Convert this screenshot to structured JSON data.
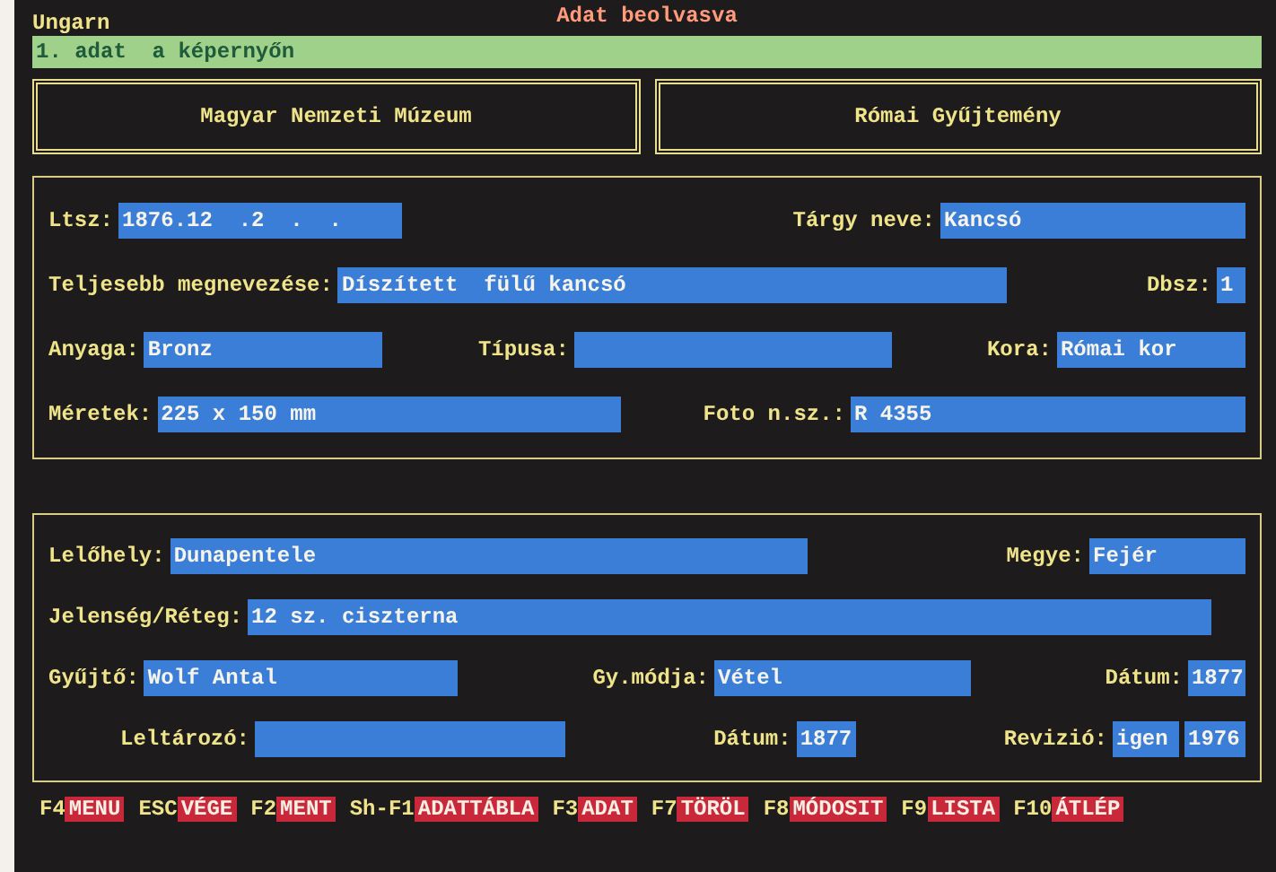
{
  "header": {
    "title": "Ungarn",
    "status": "Adat beolvasva"
  },
  "message": "1. adat  a képernyőn",
  "collections": [
    "Magyar Nemzeti Múzeum",
    "Római Gyűjtemény"
  ],
  "panels": [
    {
      "rows": [
        [
          {
            "label": "Ltsz:",
            "values": [
              "1876.12  .2  .  ."
            ]
          },
          {
            "label": "Tárgy neve:",
            "values": [
              "Kancsó"
            ]
          }
        ],
        [
          {
            "label": "Teljesebb megnevezése:",
            "values": [
              "Díszített  fülű kancsó"
            ]
          },
          {
            "label": "Dbsz:",
            "values": [
              "1"
            ]
          }
        ],
        [
          {
            "label": "Anyaga:",
            "values": [
              "Bronz"
            ]
          },
          {
            "label": "Típusa:"
          },
          {
            "label": "Kora:",
            "values": [
              "Római kor"
            ]
          }
        ],
        [
          {
            "label": "Méretek:",
            "values": [
              "225 x 150 mm"
            ]
          },
          {
            "label": "Foto n.sz.:",
            "values": [
              "R 4355"
            ]
          }
        ]
      ]
    },
    {
      "rows": [
        [
          {
            "label": "Lelőhely:",
            "values": [
              "Dunapentele"
            ]
          },
          {
            "label": "Megye:",
            "values": [
              "Fejér"
            ]
          }
        ],
        [
          {
            "label": "Jelenség/Réteg:",
            "values": [
              "12 sz. ciszterna"
            ]
          }
        ],
        [
          {
            "label": "Gyűjtő:",
            "values": [
              "Wolf Antal"
            ]
          },
          {
            "label": "Gy.módja:",
            "values": [
              "Vétel"
            ]
          },
          {
            "label": "Dátum:",
            "values": [
              "1877"
            ]
          }
        ],
        [
          {
            "label": "Leltározó:"
          },
          {
            "label": "Dátum:",
            "values": [
              "1877"
            ]
          },
          {
            "label": "Revizió:",
            "values": [
              "igen",
              "1976"
            ]
          }
        ]
      ]
    }
  ],
  "function_keys": [
    {
      "key": "F4",
      "action": "MENU"
    },
    {
      "key": "ESC",
      "action": "VÉGE"
    },
    {
      "key": "F2",
      "action": "MENT"
    },
    {
      "key": "Sh-F1",
      "action": "ADATTÁBLA"
    },
    {
      "key": "F3",
      "action": "ADAT"
    },
    {
      "key": "F7",
      "action": "TÖRÖL"
    },
    {
      "key": "F8",
      "action": "MÓDOSIT"
    },
    {
      "key": "F9",
      "action": "LISTA"
    },
    {
      "key": "F10",
      "action": "ÁTLÉP"
    }
  ]
}
